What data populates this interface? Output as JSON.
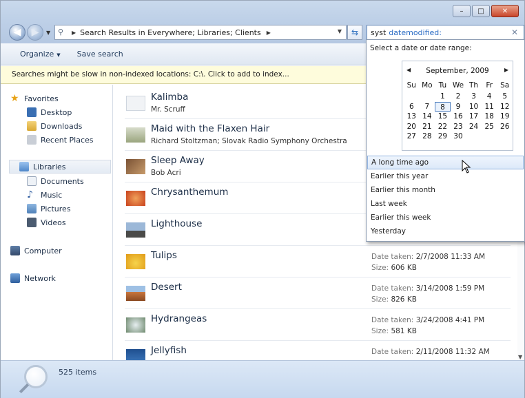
{
  "window": {
    "controls": {
      "minimize": "–",
      "maximize": "□",
      "close": "✕"
    }
  },
  "address": {
    "path": "Search Results in Everywhere; Libraries; Clients"
  },
  "search": {
    "query_term": "syst",
    "query_filter": "datemodified:"
  },
  "toolbar": {
    "organize_label": "Organize",
    "save_search_label": "Save search"
  },
  "infobar": {
    "text": "Searches might be slow in non-indexed locations: C:\\. Click to add to index..."
  },
  "sidebar": {
    "favorites": "Favorites",
    "desktop": "Desktop",
    "downloads": "Downloads",
    "recent_places": "Recent Places",
    "libraries": "Libraries",
    "documents": "Documents",
    "music": "Music",
    "pictures": "Pictures",
    "videos": "Videos",
    "computer": "Computer",
    "network": "Network"
  },
  "results": [
    {
      "title": "Kalimba",
      "subtitle": "Mr. Scruff"
    },
    {
      "title": "Maid with the Flaxen Hair",
      "subtitle": "Richard Stoltzman; Slovak Radio Symphony Orchestra"
    },
    {
      "title": "Sleep Away",
      "subtitle": "Bob Acri"
    },
    {
      "title": "Chrysanthemum",
      "subtitle": ""
    },
    {
      "title": "Lighthouse",
      "subtitle": ""
    },
    {
      "title": "Tulips",
      "date_label": "Date taken:",
      "date": "2/7/2008 11:33 AM",
      "size_label": "Size:",
      "size": "606 KB"
    },
    {
      "title": "Desert",
      "date_label": "Date taken:",
      "date": "3/14/2008 1:59 PM",
      "size_label": "Size:",
      "size": "826 KB"
    },
    {
      "title": "Hydrangeas",
      "date_label": "Date taken:",
      "date": "3/24/2008 4:41 PM",
      "size_label": "Size:",
      "size": "581 KB"
    },
    {
      "title": "Jellyfish",
      "date_label": "Date taken:",
      "date": "2/11/2008 11:32 AM"
    }
  ],
  "status": {
    "item_count": "525 items"
  },
  "date_picker": {
    "prompt": "Select a date or date range:",
    "month_year": "September, 2009",
    "weekdays": [
      "Su",
      "Mo",
      "Tu",
      "We",
      "Th",
      "Fr",
      "Sa"
    ],
    "days": [
      "",
      "",
      "1",
      "2",
      "3",
      "4",
      "5",
      "6",
      "7",
      "8",
      "9",
      "10",
      "11",
      "12",
      "13",
      "14",
      "15",
      "16",
      "17",
      "18",
      "19",
      "20",
      "21",
      "22",
      "23",
      "24",
      "25",
      "26",
      "27",
      "28",
      "29",
      "30",
      "",
      "",
      ""
    ],
    "selected_day": "8",
    "ranges": [
      "A long time ago",
      "Earlier this year",
      "Earlier this month",
      "Last week",
      "Earlier this week",
      "Yesterday"
    ],
    "hovered_range": "A long time ago"
  }
}
